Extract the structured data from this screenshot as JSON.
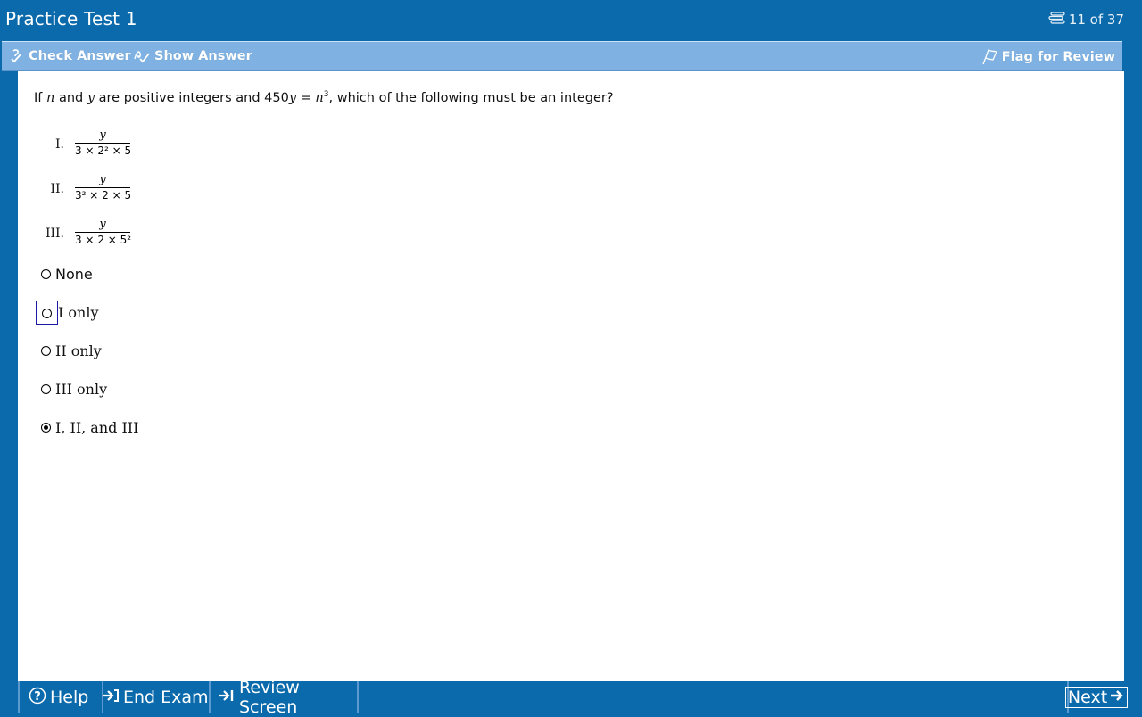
{
  "window": {
    "title": "Practice Test 1",
    "counter": "11 of 37"
  },
  "toolbar": {
    "check_answer": "Check Answer",
    "show_answer": "Show Answer",
    "flag_for_review": "Flag for Review"
  },
  "question": {
    "prefix": "If ",
    "var_n": "n",
    "mid1": " and ",
    "var_y": "y",
    "mid2": " are positive integers and 450",
    "var_y2": "y",
    "mid3": " = ",
    "var_n2": "n",
    "exp": "3",
    "suffix": ", which of the following must be an integer?"
  },
  "statements": [
    {
      "numeral": "I.",
      "numerator": "y",
      "denominator": "3 × 2² × 5"
    },
    {
      "numeral": "II.",
      "numerator": "y",
      "denominator": "3² × 2 × 5"
    },
    {
      "numeral": "III.",
      "numerator": "y",
      "denominator": "3 × 2 × 5²"
    }
  ],
  "options": [
    {
      "label": "None",
      "selected": false
    },
    {
      "label": "I only",
      "selected": false,
      "focused": true
    },
    {
      "label": "II only",
      "selected": false
    },
    {
      "label": "III only",
      "selected": false
    },
    {
      "label": "I, II, and III",
      "selected": true
    }
  ],
  "bottom": {
    "help": "Help",
    "end_exam": "End Exam",
    "review_screen": "Review Screen",
    "next": "Next"
  },
  "colors": {
    "frame_blue": "#0a6aab",
    "toolbar_blue": "#7fb2e2",
    "focus_border": "#1a1aa6"
  }
}
